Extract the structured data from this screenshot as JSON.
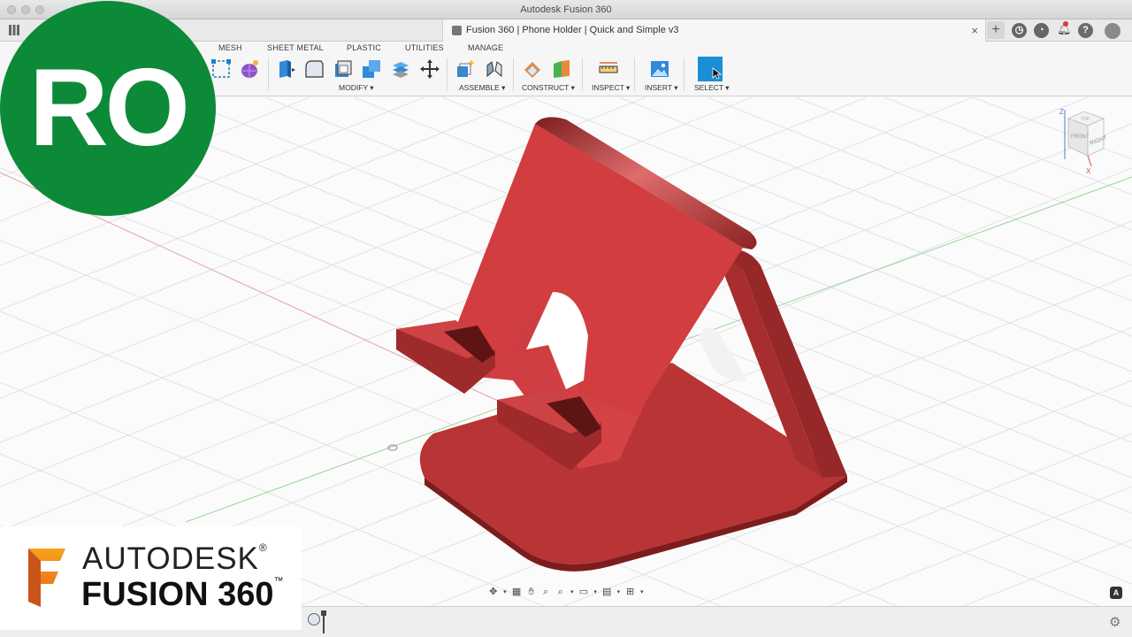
{
  "window": {
    "title": "Autodesk Fusion 360"
  },
  "document": {
    "tab_title": "Fusion 360 | Phone Holder | Quick and Simple v3",
    "close_glyph": "×",
    "new_tab_glyph": "+"
  },
  "toolbar": {
    "tabs": [
      "MESH",
      "SHEET METAL",
      "PLASTIC",
      "UTILITIES",
      "MANAGE"
    ],
    "groups": [
      "MODIFY ▾",
      "ASSEMBLE ▾",
      "CONSTRUCT ▾",
      "INSPECT ▾",
      "INSERT ▾",
      "SELECT ▾"
    ]
  },
  "viewcube": {
    "faces": [
      "RIGHT",
      "FRONT",
      "TOP"
    ],
    "axes": [
      "Z",
      "X"
    ]
  },
  "overlay": {
    "badge": "RO"
  },
  "logo": {
    "brand": "AUTODESK",
    "registered": "®",
    "product": "FUSION 360",
    "trademark": "™",
    "mark": "F"
  },
  "colors": {
    "model": "#c2393a",
    "badge": "#0d8a38",
    "select_active": "#1a8fd6"
  },
  "icons": [
    "help-icon",
    "notification-icon",
    "job-status-icon",
    "online-status-icon",
    "user-avatar-icon",
    "settings-icon"
  ]
}
